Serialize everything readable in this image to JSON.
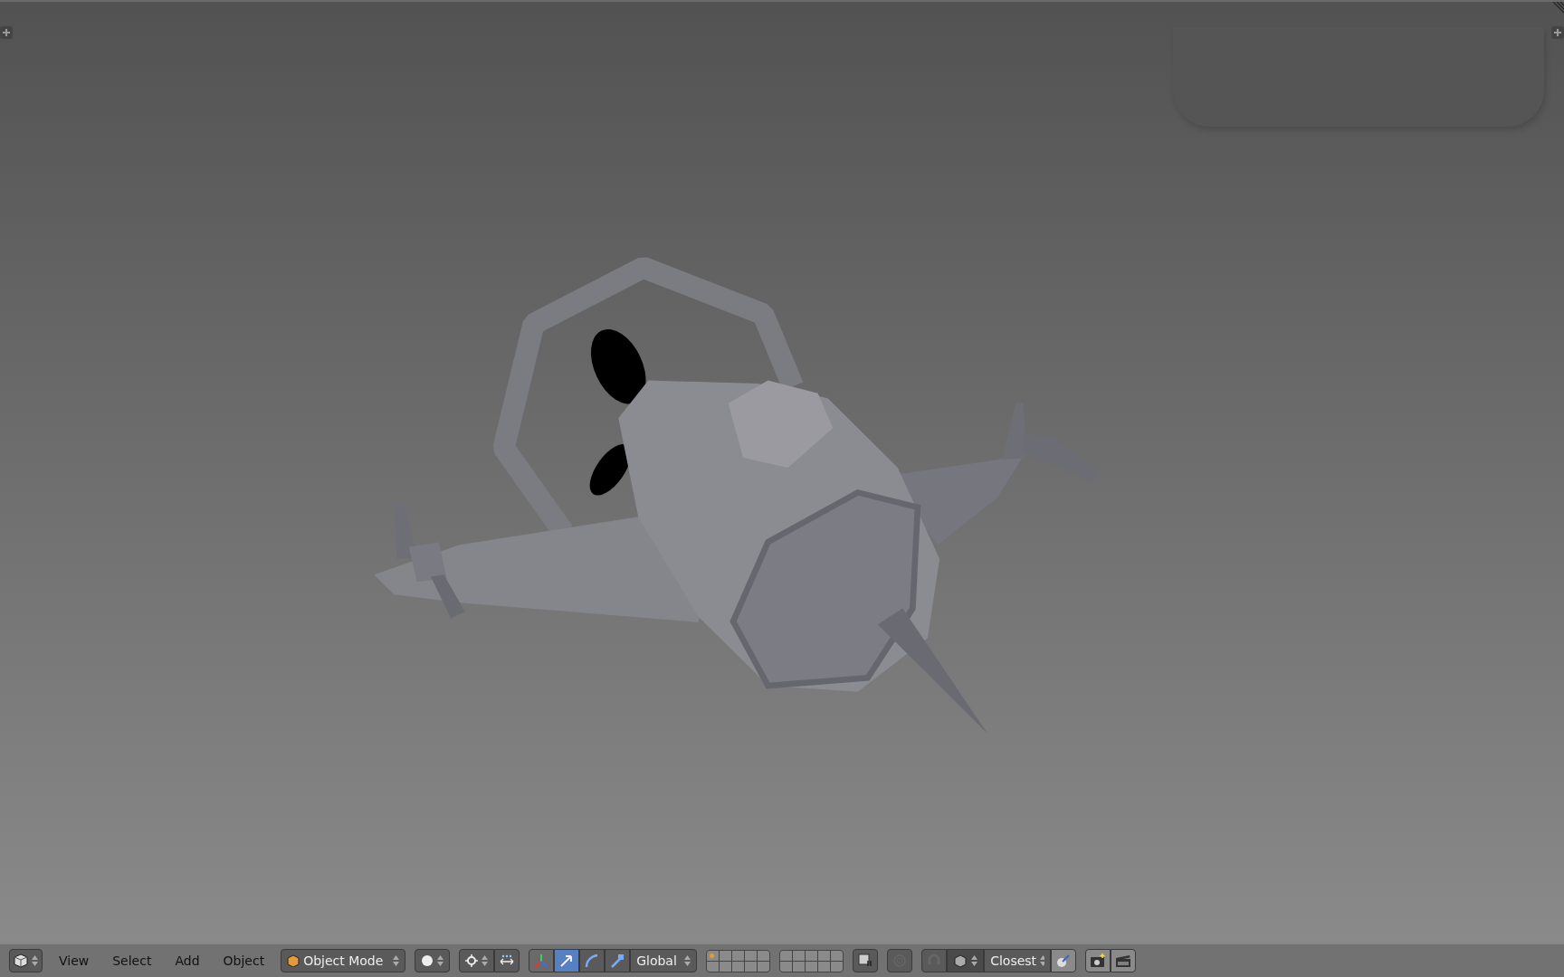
{
  "header": {
    "menus": [
      "View",
      "Select",
      "Add",
      "Object"
    ],
    "mode": {
      "label": "Object Mode"
    },
    "manipulator": {
      "on": true
    },
    "transforms": [
      {
        "kind": "translate",
        "selected": true
      },
      {
        "kind": "rotate",
        "selected": false
      },
      {
        "kind": "scale",
        "selected": false
      }
    ],
    "orientation": "Global",
    "layers": [
      {
        "has_object": true
      },
      {
        "has_object": false
      },
      {
        "has_object": false
      },
      {
        "has_object": false
      },
      {
        "has_object": false
      },
      {
        "has_object": false
      },
      {
        "has_object": false
      },
      {
        "has_object": false
      },
      {
        "has_object": false
      },
      {
        "has_object": false
      },
      {
        "has_object": false
      },
      {
        "has_object": false
      },
      {
        "has_object": false
      },
      {
        "has_object": false
      },
      {
        "has_object": false
      },
      {
        "has_object": false
      },
      {
        "has_object": false
      },
      {
        "has_object": false
      },
      {
        "has_object": false
      },
      {
        "has_object": false
      }
    ],
    "proportional_editing": {
      "on": false
    },
    "snap": {
      "on": false,
      "target": "Closest"
    }
  }
}
